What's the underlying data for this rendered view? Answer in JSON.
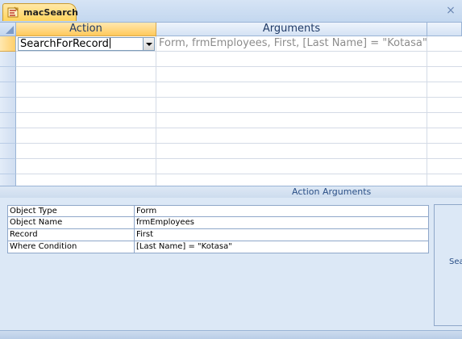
{
  "tab": {
    "label": "macSearch",
    "icon": "macro-icon"
  },
  "window": {
    "close_glyph": "×"
  },
  "grid": {
    "columns": {
      "action": "Action",
      "arguments": "Arguments"
    },
    "rows": [
      {
        "action": "SearchForRecord",
        "arguments": "Form, frmEmployees, First, [Last Name] = \"Kotasa\""
      }
    ]
  },
  "arguments_panel": {
    "title": "Action Arguments",
    "properties": [
      {
        "label": "Object Type",
        "value": "Form"
      },
      {
        "label": "Object Name",
        "value": "frmEmployees"
      },
      {
        "label": "Record",
        "value": "First"
      },
      {
        "label": "Where Condition",
        "value": "[Last Name] = \"Kotasa\""
      }
    ],
    "help_text_fragment": "Sea"
  },
  "colors": {
    "accent": "#ffc95c",
    "header_border": "#9ab4d6",
    "panel_bg": "#dce8f6"
  }
}
